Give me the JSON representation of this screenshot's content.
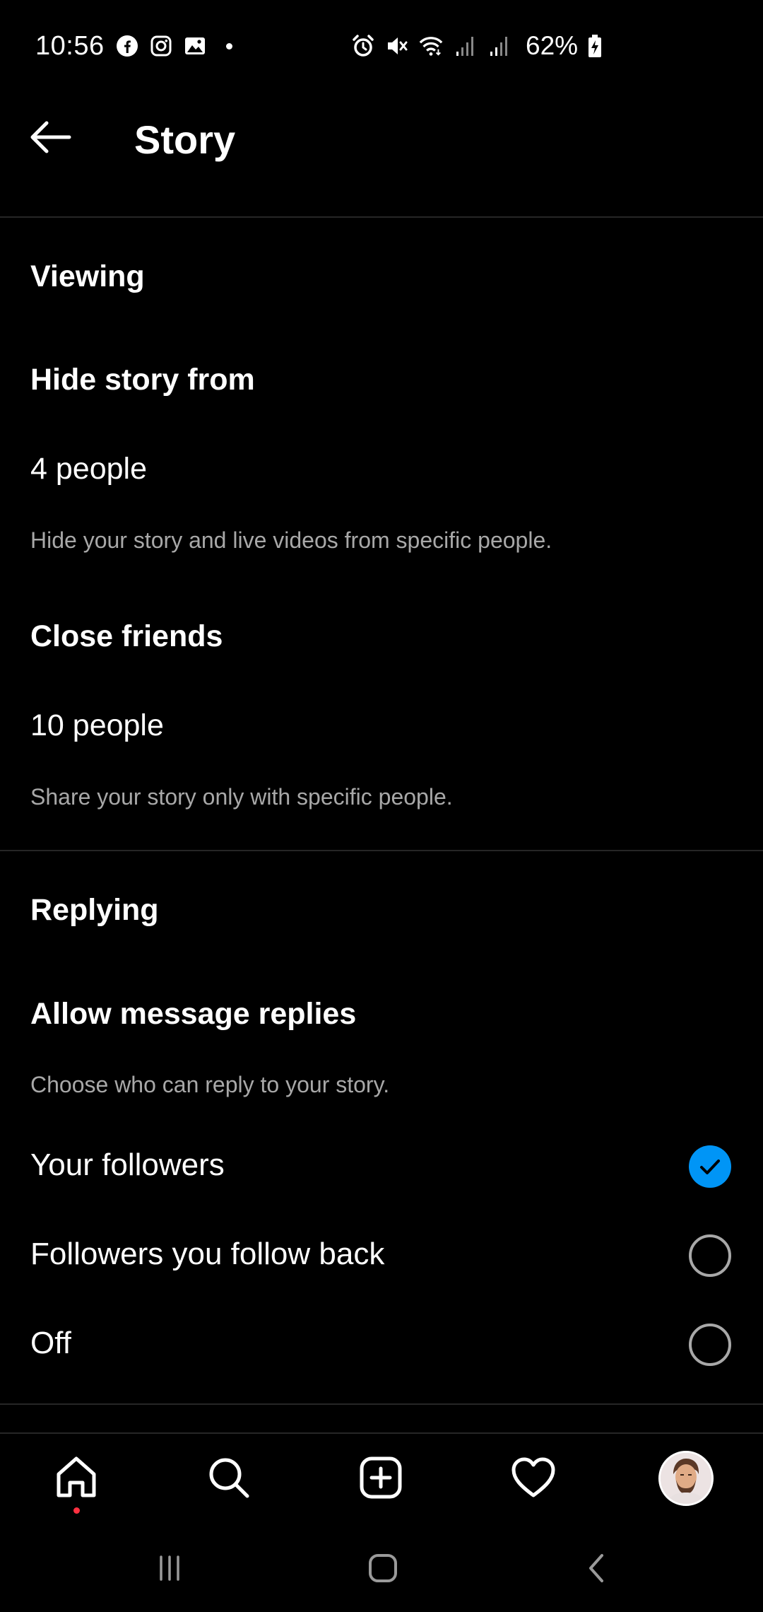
{
  "status_bar": {
    "time": "10:56",
    "battery": "62%",
    "left_icons": [
      "facebook-icon",
      "instagram-icon",
      "gallery-icon"
    ],
    "right_icons": [
      "alarm-icon",
      "mute-icon",
      "wifi-icon",
      "signal-icon",
      "signal-icon",
      "battery-charging-icon"
    ]
  },
  "header": {
    "title": "Story",
    "back_icon": "arrow-left-icon"
  },
  "viewing": {
    "heading": "Viewing",
    "hide_story": {
      "label": "Hide story from",
      "value": "4 people",
      "description": "Hide your story and live videos from specific people."
    },
    "close_friends": {
      "label": "Close friends",
      "value": "10 people",
      "description": "Share your story only with specific people."
    }
  },
  "replying": {
    "heading": "Replying",
    "allow_replies": {
      "label": "Allow message replies",
      "description": "Choose who can reply to your story."
    },
    "options": [
      {
        "label": "Your followers",
        "selected": true
      },
      {
        "label": "Followers you follow back",
        "selected": false
      },
      {
        "label": "Off",
        "selected": false
      }
    ]
  },
  "bottom_nav": {
    "items": [
      "home-icon",
      "search-icon",
      "create-icon",
      "activity-heart-icon",
      "profile-avatar"
    ],
    "home_has_notification": true
  },
  "system_nav": {
    "items": [
      "recents-icon",
      "home-square-icon",
      "back-chevron-icon"
    ]
  },
  "colors": {
    "background": "#000000",
    "primary_text": "#ffffff",
    "secondary_text": "#a8a8a8",
    "divider": "#262626",
    "accent": "#0095f6",
    "notification": "#ff3040"
  }
}
